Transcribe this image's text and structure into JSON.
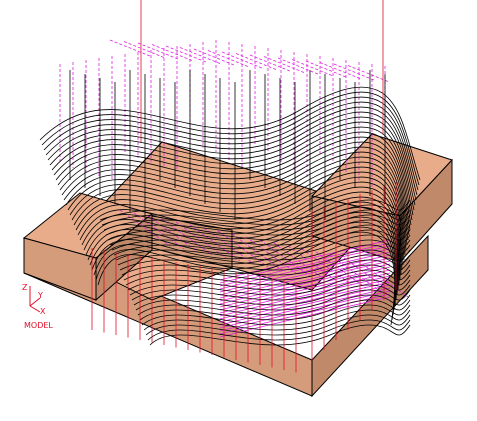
{
  "triad": {
    "x_label": "X",
    "y_label": "Y",
    "z_label": "Z",
    "coord_label": "MODEL"
  },
  "colors": {
    "background": "#ffffff",
    "part_top": "#e8ac8a",
    "part_front": "#d59c7c",
    "part_side": "#c0896a",
    "edge": "#000000",
    "toolpath_black": "#000000",
    "toolpath_magenta": "#e020e0",
    "toolpath_red": "#e0102a",
    "triad": "#e0102a"
  },
  "icons": {
    "triad": "coordinate-triad-icon"
  }
}
